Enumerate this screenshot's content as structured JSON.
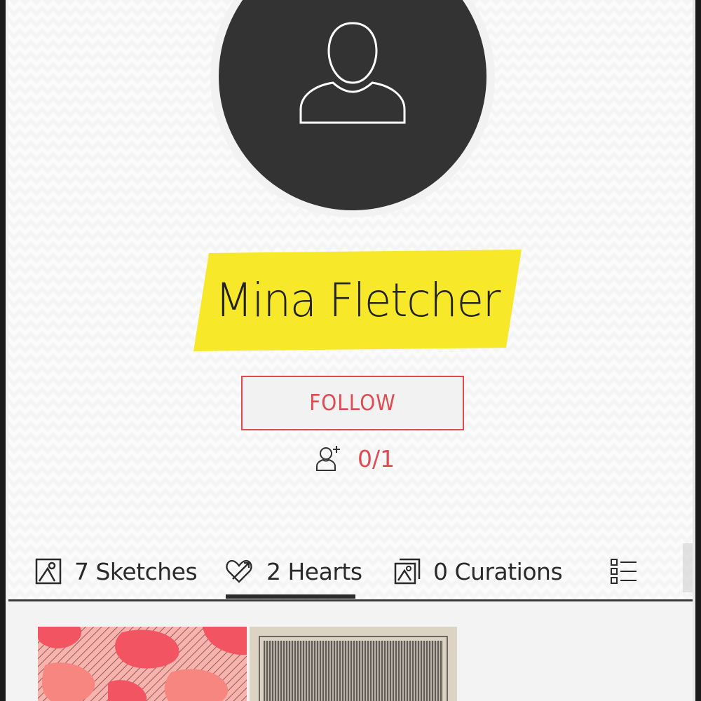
{
  "profile": {
    "name": "Mina Fletcher",
    "follow_label": "FOLLOW",
    "followers_count": "0/1",
    "avatar_icon": "user-silhouette-icon",
    "banner_color": "#f7e82a",
    "accent_color": "#e04a50"
  },
  "tabs": [
    {
      "icon": "sketch-icon",
      "label": "7 Sketches",
      "active": false
    },
    {
      "icon": "hearts-icon",
      "label": "2 Hearts",
      "active": true
    },
    {
      "icon": "curations-icon",
      "label": "0 Curations",
      "active": false
    },
    {
      "icon": "list-view-icon",
      "label": "",
      "active": false
    }
  ],
  "gallery": {
    "items": [
      {
        "name": "pink-pattern-sketch"
      },
      {
        "name": "striped-beige-sketch"
      }
    ]
  }
}
